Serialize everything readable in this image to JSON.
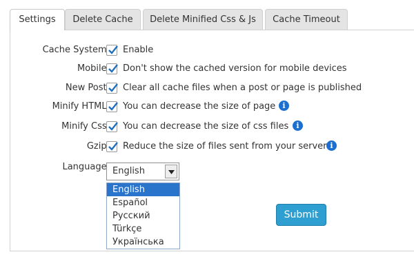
{
  "tabs": [
    {
      "label": "Settings",
      "active": true
    },
    {
      "label": "Delete Cache",
      "active": false
    },
    {
      "label": "Delete Minified Css & Js",
      "active": false
    },
    {
      "label": "Cache Timeout",
      "active": false
    }
  ],
  "settings": [
    {
      "label": "Cache System:",
      "checked": true,
      "description": "Enable",
      "info": false
    },
    {
      "label": "Mobile:",
      "checked": true,
      "description": "Don't show the cached version for mobile devices",
      "info": false
    },
    {
      "label": "New Post:",
      "checked": true,
      "description": "Clear all cache files when a post or page is published",
      "info": false
    },
    {
      "label": "Minify HTML:",
      "checked": true,
      "description": "You can decrease the size of page",
      "info": true
    },
    {
      "label": "Minify Css:",
      "checked": true,
      "description": "You can decrease the size of css files",
      "info": true
    },
    {
      "label": "Gzip:",
      "checked": true,
      "description": "Reduce the size of files sent from your server",
      "info": true
    }
  ],
  "language": {
    "label": "Language:",
    "selected": "English",
    "options": [
      "English",
      "Español",
      "Русский",
      "Türkçe",
      "Українська"
    ]
  },
  "submit_label": "Submit",
  "colors": {
    "accent": "#2e9fd0",
    "info_icon": "#1a6fd1",
    "selected_option": "#2a74cc",
    "checkmark": "#1f6fbf"
  }
}
